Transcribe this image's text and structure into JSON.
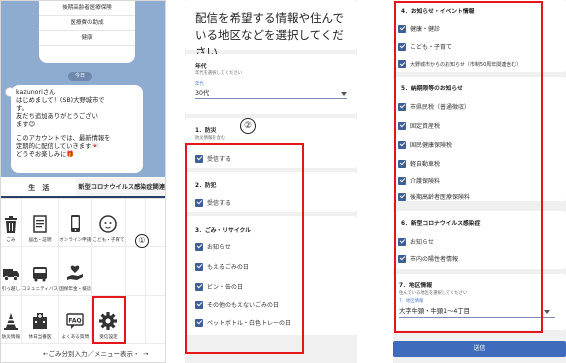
{
  "chat": {
    "top_items": [
      "後期高齢者医療保険",
      "医療費の助成",
      "健康"
    ],
    "date_label": "今日",
    "message_lines": [
      "kazunoriさん",
      "はじめまして！(SB)大野城市で",
      "す。",
      "友だち追加ありがとうござい",
      "ます😉",
      "",
      "このアカウントでは、最新情報を",
      "定期的に配信していきます💌",
      "どうぞお楽しみに🎁"
    ]
  },
  "rich_menu": {
    "tabs": [
      "生　活",
      "新型コロナウイルス感染症関連"
    ],
    "items": [
      {
        "label": "ごみ",
        "icon": "trash-icon"
      },
      {
        "label": "届出・証明",
        "icon": "document-icon"
      },
      {
        "label": "オンライン申請",
        "icon": "smartphone-icon"
      },
      {
        "label": "こども・子育て",
        "icon": "baby-icon"
      },
      {
        "label": "",
        "icon": "blank"
      },
      {
        "label": "",
        "icon": "blank"
      },
      {
        "label": "引っ越し",
        "icon": "truck-icon"
      },
      {
        "label": "コミュニティバス",
        "icon": "bus-icon"
      },
      {
        "label": "国保年金・検診",
        "icon": "hand-heart-icon"
      },
      {
        "label": "",
        "icon": "blank"
      },
      {
        "label": "",
        "icon": "blank"
      },
      {
        "label": "",
        "icon": "blank"
      },
      {
        "label": "防災情報",
        "icon": "cone-icon"
      },
      {
        "label": "休日当番医",
        "icon": "hospital-icon"
      },
      {
        "label": "よくある質問",
        "icon": "faq-icon"
      },
      {
        "label": "受信設定",
        "icon": "gear-icon"
      },
      {
        "label": "",
        "icon": "blank"
      },
      {
        "label": "",
        "icon": "blank"
      }
    ],
    "footer": "←ごみ分別入力／メニュー表示・",
    "footer_arrow": "→",
    "marker": "①"
  },
  "form_left": {
    "hero": "配信を希望する情報や住んでいる地区などを選択してください",
    "age": {
      "title": "年代",
      "subtitle": "年代を選択してください",
      "field_label": "年代",
      "value": "30代"
    },
    "marker": "②",
    "sections": [
      {
        "title": "1．防災",
        "subtitle": "防災情報を含む",
        "options": [
          "受信する"
        ]
      },
      {
        "title": "2．防犯",
        "subtitle": "",
        "options": [
          "受信する"
        ]
      },
      {
        "title": "3．ごみ・リサイクル",
        "subtitle": "",
        "options": [
          "お知らせ",
          "もえるごみの日",
          "ビン・缶の日",
          "その他のもえないごみの日",
          "ペットボトル・白色トレーの日"
        ]
      }
    ]
  },
  "form_right": {
    "sections": [
      {
        "title": "4．お知らせ・イベント情報",
        "options": [
          "健康・健診",
          "こども・子育て",
          "大野城市からのお知らせ（市制50周年関連含む）"
        ]
      },
      {
        "title": "5．納期限等のお知らせ",
        "options": [
          "市県民税（普通徴収）",
          "固定資産税",
          "国民健康保険税",
          "軽自動車税",
          "介護保険料",
          "後期高齢者医療保険料"
        ]
      },
      {
        "title": "6．新型コロナウイルス感染症",
        "options": [
          "お知らせ",
          "市内の陽性者情報"
        ]
      }
    ],
    "district": {
      "title": "7．地区情報",
      "subtitle": "住んでいる地区を選択してください",
      "field_label": "7．地区情報",
      "value": "大字牛頸・牛頸1〜4丁目"
    },
    "submit_label": "送信"
  },
  "colors": {
    "accent": "#3f5e96",
    "highlight": "#e4151b",
    "chat_bg": "#8eabd0",
    "submit": "#3f6bbd"
  }
}
